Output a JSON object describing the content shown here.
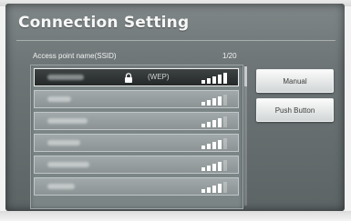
{
  "screen": {
    "title": "Connection Setting"
  },
  "list": {
    "header": "Access point name(SSID)",
    "count": "1/20",
    "rows": [
      {
        "selected": true,
        "secured": true,
        "encryption": "(WEP)",
        "signal_bars": 5
      },
      {
        "selected": false,
        "secured": false,
        "encryption": "",
        "signal_bars": 4
      },
      {
        "selected": false,
        "secured": false,
        "encryption": "",
        "signal_bars": 4
      },
      {
        "selected": false,
        "secured": false,
        "encryption": "",
        "signal_bars": 4
      },
      {
        "selected": false,
        "secured": false,
        "encryption": "",
        "signal_bars": 4
      },
      {
        "selected": false,
        "secured": false,
        "encryption": "",
        "signal_bars": 4
      }
    ]
  },
  "actions": {
    "manual_label": "Manual",
    "push_button_label": "Push Button"
  },
  "icons": {
    "lock": "lock-icon",
    "signal": "signal-strength-icon"
  },
  "colors": {
    "selected_row": "#2f3435",
    "row": "#979fa0",
    "background": "#6d7576"
  }
}
